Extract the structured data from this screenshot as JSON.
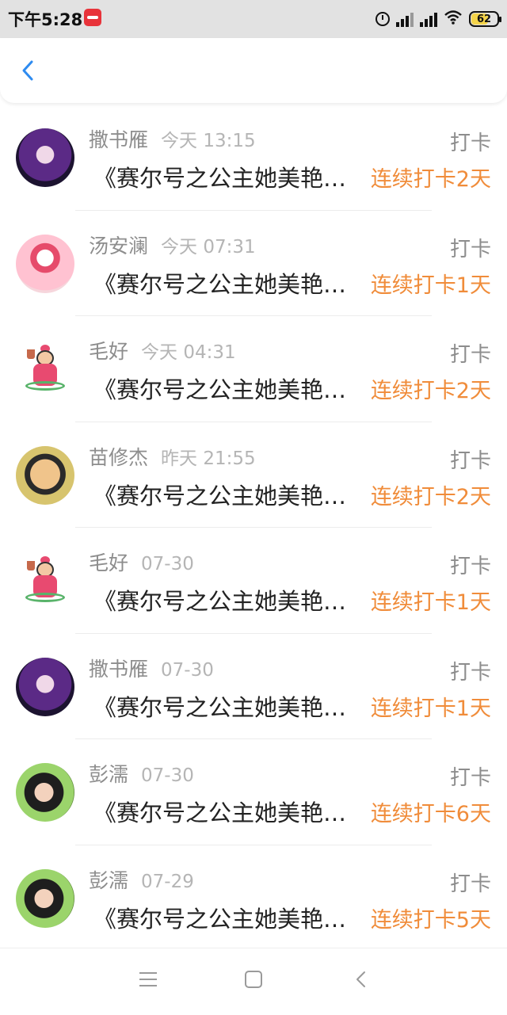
{
  "status_bar": {
    "time": "下午5:28",
    "battery": "62",
    "icons": [
      "app-icon",
      "alarm-icon",
      "signal-icon",
      "signal-icon",
      "wifi-icon",
      "battery-icon"
    ]
  },
  "header": {
    "back_icon": "chevron-left-icon"
  },
  "colors": {
    "accent_orange": "#f08c3a",
    "back_blue": "#2e8bf0",
    "muted_text": "#8d8d8d"
  },
  "list": [
    {
      "name": "撒书雁",
      "time": "今天 13:15",
      "title": "《赛尔号之公主她美艳动人》",
      "tag": "打卡",
      "streak": "连续打卡2天"
    },
    {
      "name": "汤安澜",
      "time": "今天 07:31",
      "title": "《赛尔号之公主她美艳动人》",
      "tag": "打卡",
      "streak": "连续打卡1天"
    },
    {
      "name": "毛好",
      "time": "今天 04:31",
      "title": "《赛尔号之公主她美艳动人》",
      "tag": "打卡",
      "streak": "连续打卡2天"
    },
    {
      "name": "苗修杰",
      "time": "昨天 21:55",
      "title": "《赛尔号之公主她美艳动人》",
      "tag": "打卡",
      "streak": "连续打卡2天"
    },
    {
      "name": "毛好",
      "time": "07-30",
      "title": "《赛尔号之公主她美艳动人》",
      "tag": "打卡",
      "streak": "连续打卡1天"
    },
    {
      "name": "撒书雁",
      "time": "07-30",
      "title": "《赛尔号之公主她美艳动人》",
      "tag": "打卡",
      "streak": "连续打卡1天"
    },
    {
      "name": "彭濡",
      "time": "07-30",
      "title": "《赛尔号之公主她美艳动人》",
      "tag": "打卡",
      "streak": "连续打卡6天"
    },
    {
      "name": "彭濡",
      "time": "07-29",
      "title": "《赛尔号之公主她美艳动人》",
      "tag": "打卡",
      "streak": "连续打卡5天"
    }
  ],
  "navbar": {
    "icons": [
      "menu-icon",
      "home-icon",
      "back-icon"
    ]
  }
}
